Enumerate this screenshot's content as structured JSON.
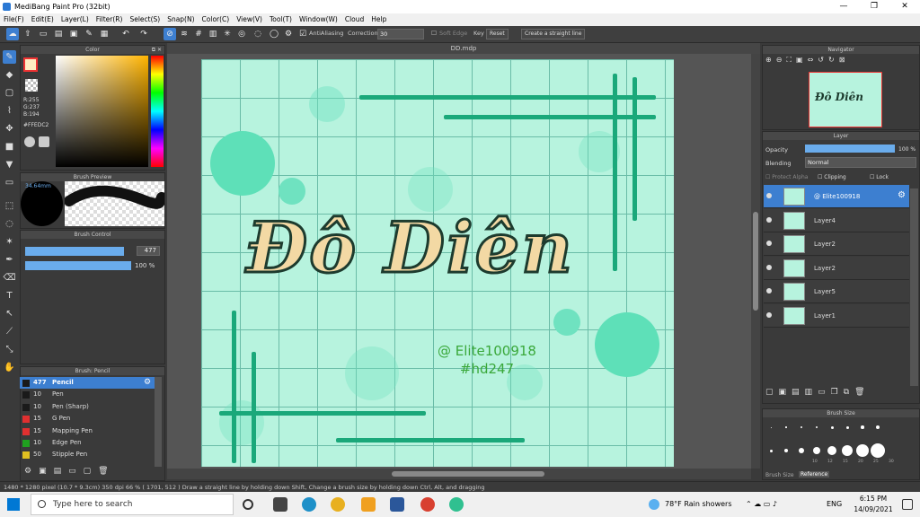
{
  "window": {
    "title": "MediBang Paint Pro (32bit)",
    "minimize": "—",
    "maximize": "❐",
    "close": "✕"
  },
  "menu": [
    "File(F)",
    "Edit(E)",
    "Layer(L)",
    "Filter(R)",
    "Select(S)",
    "Snap(N)",
    "Color(C)",
    "View(V)",
    "Tool(T)",
    "Window(W)",
    "Cloud",
    "Help"
  ],
  "toolbar": {
    "antialias": "AntiAliasing",
    "correction_label": "Correction",
    "correction_value": "30",
    "soft_edge": "Soft Edge",
    "key": "Key",
    "reset": "Reset",
    "straight_line": "Create a straight line"
  },
  "color_panel": {
    "title": "Color",
    "r": "R:255",
    "g": "G:237",
    "b": "B:194",
    "hex": "#FFEDC2",
    "fg": "#ffedc2"
  },
  "brush_preview": {
    "title": "Brush Preview",
    "size": "34.64mm"
  },
  "brush_control": {
    "title": "Brush Control",
    "size_value": "477",
    "size_fill": 0.9,
    "opacity_value": "100 %",
    "opacity_fill": 1.0
  },
  "brush_list": {
    "title": "Brush: Pencil",
    "items": [
      {
        "num": "477",
        "name": "Pencil",
        "color": "#1a1a1a"
      },
      {
        "num": "10",
        "name": "Pen",
        "color": "#1a1a1a"
      },
      {
        "num": "10",
        "name": "Pen (Sharp)",
        "color": "#1a1a1a"
      },
      {
        "num": "15",
        "name": "G Pen",
        "color": "#e03030"
      },
      {
        "num": "15",
        "name": "Mapping Pen",
        "color": "#e03030"
      },
      {
        "num": "10",
        "name": "Edge Pen",
        "color": "#20a020"
      },
      {
        "num": "50",
        "name": "Stipple Pen",
        "color": "#e0c020"
      }
    ]
  },
  "document": {
    "tab": "DD.mdp"
  },
  "artwork": {
    "title": "Đô Diên",
    "handle": "@ Elite100918",
    "tag": "#hd247"
  },
  "navigator": {
    "title": "Navigator"
  },
  "layer_panel": {
    "title": "Layer",
    "opacity_label": "Opacity",
    "opacity_value": "100 %",
    "opacity_fill": 1.0,
    "blending_label": "Blending",
    "blending_value": "Normal",
    "protect_alpha": "Protect Alpha",
    "clipping": "Clipping",
    "lock": "Lock",
    "layers": [
      "@ Elite100918",
      "Layer4",
      "Layer2",
      "Layer2",
      "Layer5",
      "Layer1"
    ]
  },
  "brush_size": {
    "title": "Brush Size",
    "labels": [
      "10",
      "12",
      "15",
      "20",
      "25",
      "30"
    ],
    "tabs": [
      "Brush Size",
      "Reference"
    ]
  },
  "status": {
    "text": "1480 * 1280 pixel   (10.7 * 9.3cm)   350 dpi   66 %   ( 1701, 512 )   Draw a straight line by holding down Shift, Change a brush size by holding down Ctrl, Alt, and dragging"
  },
  "taskbar": {
    "search": "Type here to search",
    "weather": "78°F  Rain showers",
    "lang": "ENG",
    "time": "6:15 PM",
    "date": "14/09/2021"
  }
}
